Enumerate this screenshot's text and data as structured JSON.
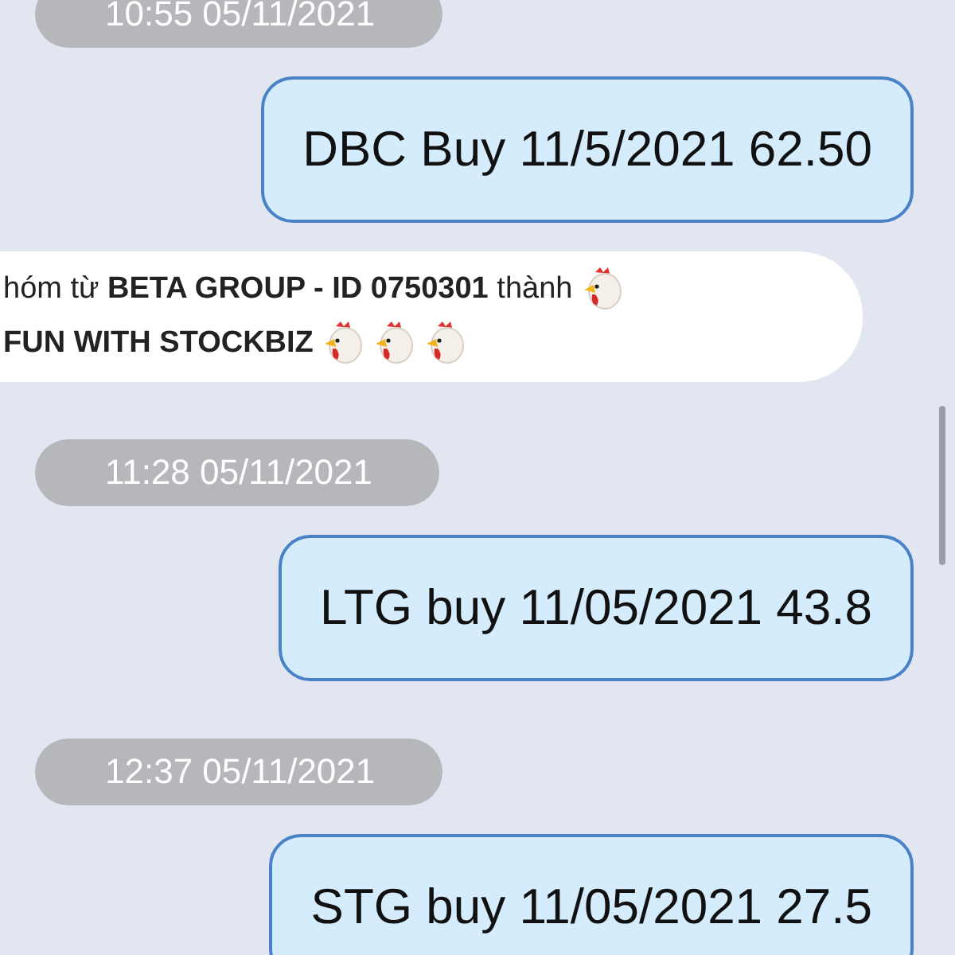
{
  "messages": [
    {
      "kind": "timestamp",
      "text": "10:55 05/11/2021"
    },
    {
      "kind": "outgoing",
      "text": "DBC Buy 11/5/2021 62.50"
    },
    {
      "kind": "system",
      "lines": [
        {
          "text": "hóm từ **BETA GROUP - ID 0750301** thành",
          "emoji": [
            {
              "kind": "chicken"
            }
          ]
        },
        {
          "text": "**FUN WITH STOCKBIZ**",
          "emoji": [
            {
              "kind": "chicken"
            },
            {
              "kind": "chicken"
            },
            {
              "kind": "chicken"
            }
          ]
        }
      ]
    },
    {
      "kind": "timestamp",
      "text": "11:28 05/11/2021"
    },
    {
      "kind": "outgoing",
      "text": "LTG buy 11/05/2021 43.8"
    },
    {
      "kind": "timestamp",
      "text": "12:37 05/11/2021"
    },
    {
      "kind": "outgoing",
      "text": "STG buy 11/05/2021 27.5"
    }
  ]
}
